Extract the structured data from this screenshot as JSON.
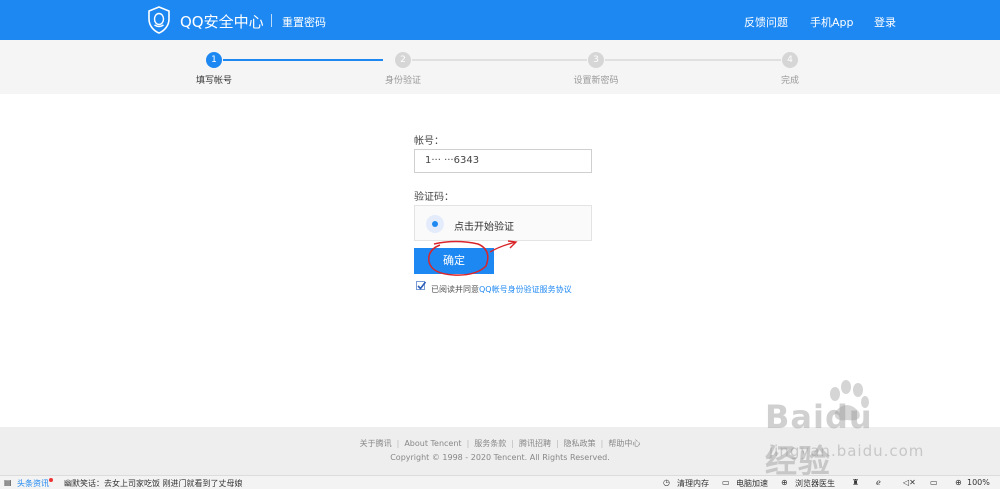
{
  "header": {
    "brand": "QQ安全中心",
    "subtitle": "重置密码",
    "links": [
      "反馈问题",
      "手机App",
      "登录"
    ],
    "bg_color": "#1e88f2"
  },
  "steps": [
    {
      "num": "1",
      "label": "填写帐号",
      "active": true
    },
    {
      "num": "2",
      "label": "身份验证",
      "active": false
    },
    {
      "num": "3",
      "label": "设置新密码",
      "active": false
    },
    {
      "num": "4",
      "label": "完成",
      "active": false
    }
  ],
  "form": {
    "account_label": "帐号：",
    "account_value": "1··· ···6343",
    "captcha_label": "验证码：",
    "captcha_text": "点击开始验证",
    "confirm_label": "确定",
    "agree_text": "已阅读并同意",
    "agree_link": "QQ帐号身份验证服务协议",
    "agree_checked": true
  },
  "footer": {
    "links": [
      "关于腾讯",
      "About Tencent",
      "服务条款",
      "腾讯招聘",
      "隐私政策",
      "帮助中心"
    ],
    "copyright": "Copyright © 1998 - 2020 Tencent. All Rights Reserved."
  },
  "statusbar": {
    "news_label": "头条资讯",
    "news_text": "幽默笑话：去女上司家吃饭 刚进门就看到了丈母娘",
    "items": [
      "清理内存",
      "电脑加速",
      "浏览器医生"
    ],
    "zoom": "100%"
  },
  "watermark": {
    "brand": "Baidu经验",
    "url": "jingyan.baidu.com"
  }
}
